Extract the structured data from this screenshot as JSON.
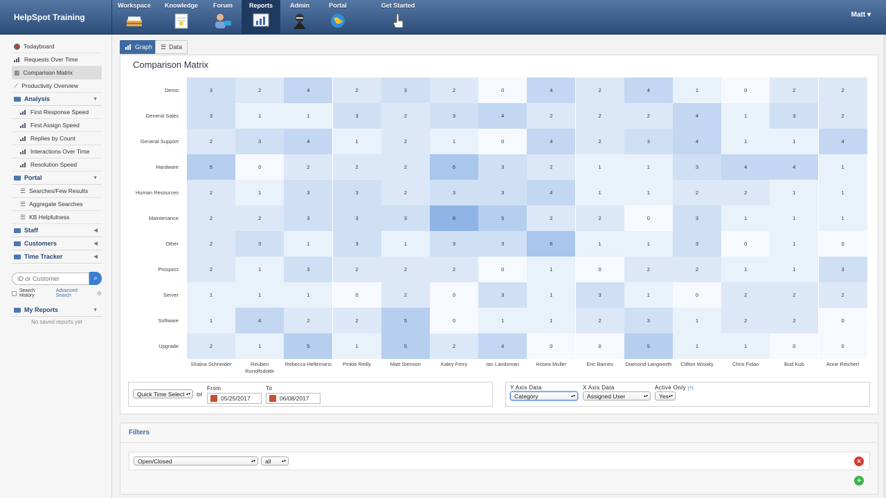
{
  "app": {
    "title": "HelpSpot Training",
    "user": "Matt"
  },
  "nav": [
    {
      "label": "Workspace",
      "icon": "inbox-tray-icon"
    },
    {
      "label": "Knowledge",
      "icon": "notebook-icon"
    },
    {
      "label": "Forum",
      "icon": "forum-people-icon"
    },
    {
      "label": "Reports",
      "icon": "report-chart-icon"
    },
    {
      "label": "Admin",
      "icon": "admin-ninja-icon"
    },
    {
      "label": "Portal",
      "icon": "globe-icon"
    },
    {
      "label": "Get Started",
      "icon": "pointer-hand-icon"
    }
  ],
  "sidebar": {
    "top_items": [
      "Todayboard",
      "Requests Over Time",
      "Comparison Matrix",
      "Productivity Overview"
    ],
    "sections": [
      {
        "title": "Analysis",
        "items": [
          "First Response Speed",
          "First Assign Speed",
          "Replies by Count",
          "Interactions Over Time",
          "Resolution Speed"
        ]
      },
      {
        "title": "Portal",
        "items": [
          "Searches/Few Results",
          "Aggregate Searches",
          "KB Helpfulness"
        ]
      },
      {
        "title": "Staff",
        "items": []
      },
      {
        "title": "Customers",
        "items": []
      },
      {
        "title": "Time Tracker",
        "items": []
      }
    ],
    "search_placeholder": "ID or Customer",
    "search_history": "Search History",
    "advanced_search": "Advanced Search",
    "my_reports": "My Reports",
    "no_saved": "No saved reports yet"
  },
  "tabs": {
    "graph": "Graph",
    "data": "Data"
  },
  "chart_data": {
    "type": "heatmap",
    "title": "Comparison Matrix",
    "rows": [
      "Demo",
      "General Sales",
      "General Support",
      "Hardware",
      "Human Resources",
      "Maintenance",
      "Other",
      "Prospect",
      "Server",
      "Software",
      "Upgrade"
    ],
    "columns": [
      "Shaina Schneider",
      "Reuben Runolfsdottir",
      "Rebecca Hellemans",
      "Pinkie Reilly",
      "Matt Stenson",
      "Kaley Ferry",
      "Ian Landsman",
      "Hosea Muller",
      "Eric Barnes",
      "Diamond Langworth",
      "Clifton Wisoky",
      "Chris Fidao",
      "Bud Kub",
      "Anne Reichert"
    ],
    "values": [
      [
        3,
        2,
        4,
        2,
        3,
        2,
        0,
        4,
        2,
        4,
        1,
        0,
        2,
        2
      ],
      [
        3,
        1,
        1,
        3,
        2,
        3,
        4,
        2,
        2,
        2,
        4,
        1,
        3,
        2
      ],
      [
        2,
        3,
        4,
        1,
        2,
        1,
        0,
        4,
        2,
        3,
        4,
        1,
        1,
        4
      ],
      [
        5,
        0,
        2,
        2,
        2,
        6,
        3,
        2,
        1,
        1,
        3,
        4,
        4,
        1
      ],
      [
        2,
        1,
        3,
        3,
        2,
        3,
        3,
        4,
        1,
        1,
        2,
        2,
        1,
        1
      ],
      [
        2,
        2,
        3,
        3,
        3,
        8,
        5,
        2,
        2,
        0,
        3,
        1,
        1,
        1
      ],
      [
        2,
        3,
        1,
        3,
        1,
        3,
        3,
        6,
        1,
        1,
        3,
        0,
        1,
        0
      ],
      [
        2,
        1,
        3,
        2,
        2,
        2,
        0,
        1,
        0,
        2,
        2,
        1,
        1,
        3
      ],
      [
        1,
        1,
        1,
        0,
        2,
        0,
        3,
        1,
        3,
        1,
        0,
        2,
        2,
        2
      ],
      [
        1,
        4,
        2,
        2,
        5,
        0,
        1,
        1,
        2,
        3,
        1,
        2,
        2,
        0
      ],
      [
        2,
        1,
        5,
        1,
        5,
        2,
        4,
        0,
        0,
        5,
        1,
        1,
        0,
        0
      ]
    ],
    "color_low": "#ffffff",
    "color_high": "#8fb5e6"
  },
  "controls": {
    "quick_time": "Quick Time Select",
    "or": "or",
    "from_label": "From",
    "from_value": "05/25/2017",
    "to_label": "To",
    "to_value": "06/08/2017",
    "y_axis_label": "Y Axis Data",
    "y_axis_value": "Category",
    "x_axis_label": "X Axis Data",
    "x_axis_value": "Assigned User",
    "active_label": "Active Only",
    "active_help": "[?]",
    "active_value": "Yes"
  },
  "filters": {
    "title": "Filters",
    "field": "Open/Closed",
    "value": "all"
  }
}
